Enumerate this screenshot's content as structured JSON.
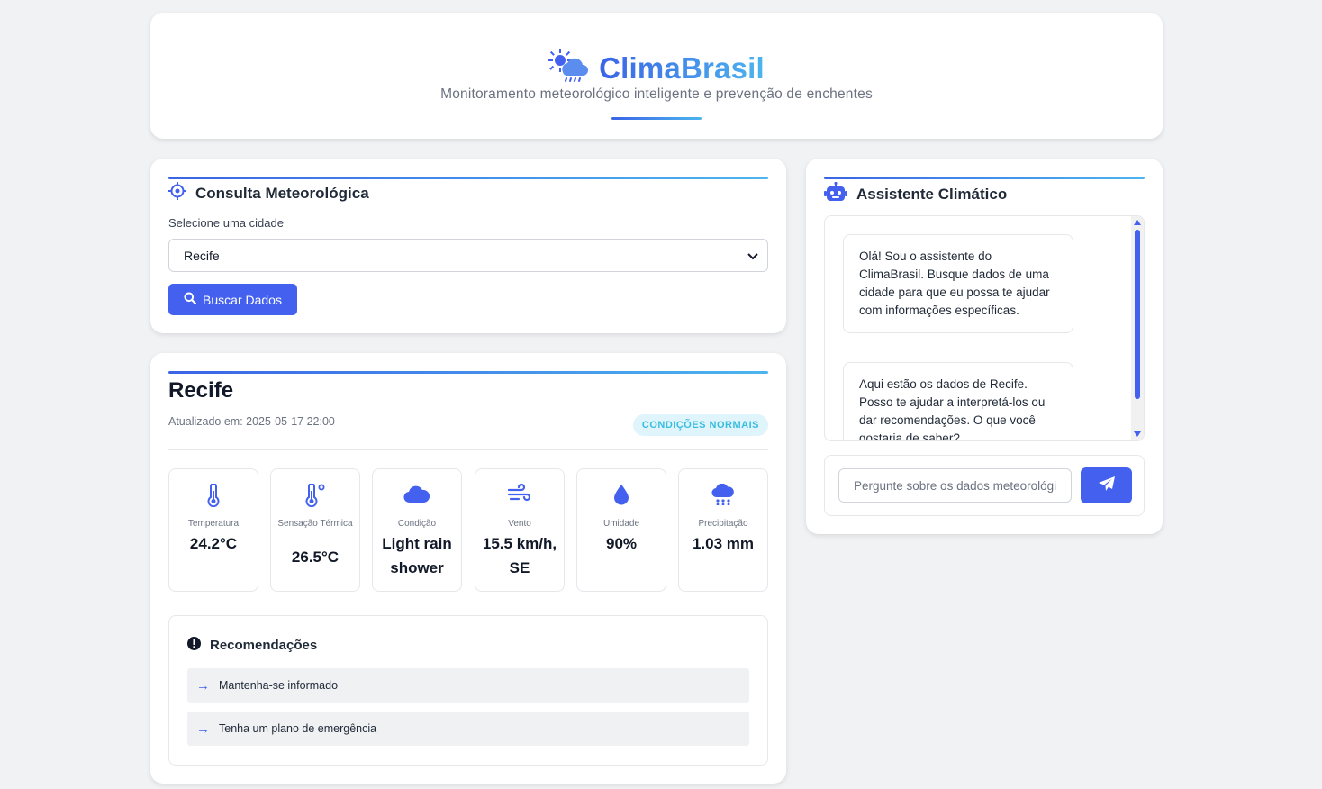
{
  "header": {
    "brand": "ClimaBrasil",
    "subtitle": "Monitoramento meteorológico inteligente e prevenção de enchentes",
    "logo_icon": "sun-cloud-rain-icon"
  },
  "consulta": {
    "title": "Consulta Meteorológica",
    "field_label": "Selecione uma cidade",
    "selected_city": "Recife",
    "button_label": "Buscar Dados"
  },
  "weather": {
    "city": "Recife",
    "updated": "Atualizado em: 2025-05-17 22:00",
    "status_badge": "CONDIÇÕES NORMAIS",
    "tiles": [
      {
        "icon": "thermometer-icon",
        "label": "Temperatura",
        "value": "24.2°C"
      },
      {
        "icon": "feels-like-icon",
        "label": "Sensação Térmica",
        "value": "26.5°C"
      },
      {
        "icon": "cloud-icon",
        "label": "Condição",
        "value": "Light rain shower"
      },
      {
        "icon": "wind-icon",
        "label": "Vento",
        "value": "15.5 km/h, SE"
      },
      {
        "icon": "droplet-icon",
        "label": "Umidade",
        "value": "90%"
      },
      {
        "icon": "cloud-rain-icon",
        "label": "Precipitação",
        "value": "1.03 mm"
      }
    ]
  },
  "recommendations": {
    "title": "Recomendações",
    "items": [
      "Mantenha-se informado",
      "Tenha um plano de emergência"
    ]
  },
  "assistant": {
    "title": "Assistente Climático",
    "messages": [
      "Olá! Sou o assistente do ClimaBrasil. Busque dados de uma cidade para que eu possa te ajudar com informações específicas.",
      "Aqui estão os dados de Recife. Posso te ajudar a interpretá-los ou dar recomendações. O que você gostaria de saber?"
    ],
    "input_placeholder": "Pergunte sobre os dados meteorológicos..."
  },
  "colors": {
    "primary": "#4361ee",
    "accent": "#4cb5ee",
    "badge_bg": "#e0f4fb",
    "badge_text": "#38bde0"
  }
}
